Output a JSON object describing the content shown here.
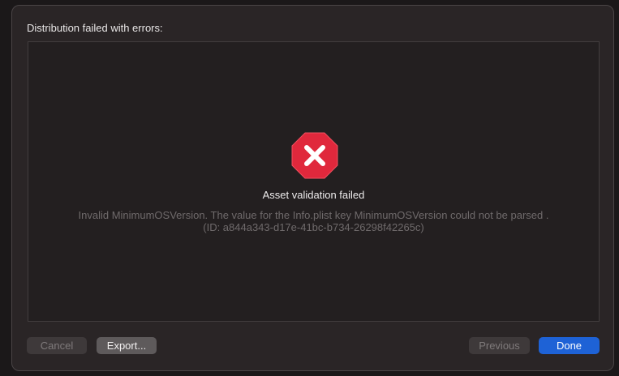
{
  "dialog": {
    "title": "Distribution failed with errors:"
  },
  "error": {
    "icon": "error-x-octagon-icon",
    "title": "Asset validation failed",
    "detail_line1": "Invalid MinimumOSVersion. The value for the Info.plist key MinimumOSVersion could not be parsed .",
    "detail_line2": "(ID: a844a343-d17e-41bc-b734-26298f42265c)"
  },
  "buttons": {
    "cancel": "Cancel",
    "export": "Export...",
    "previous": "Previous",
    "done": "Done"
  },
  "colors": {
    "error_red": "#e0283c",
    "accent_blue": "#1e62d6"
  }
}
